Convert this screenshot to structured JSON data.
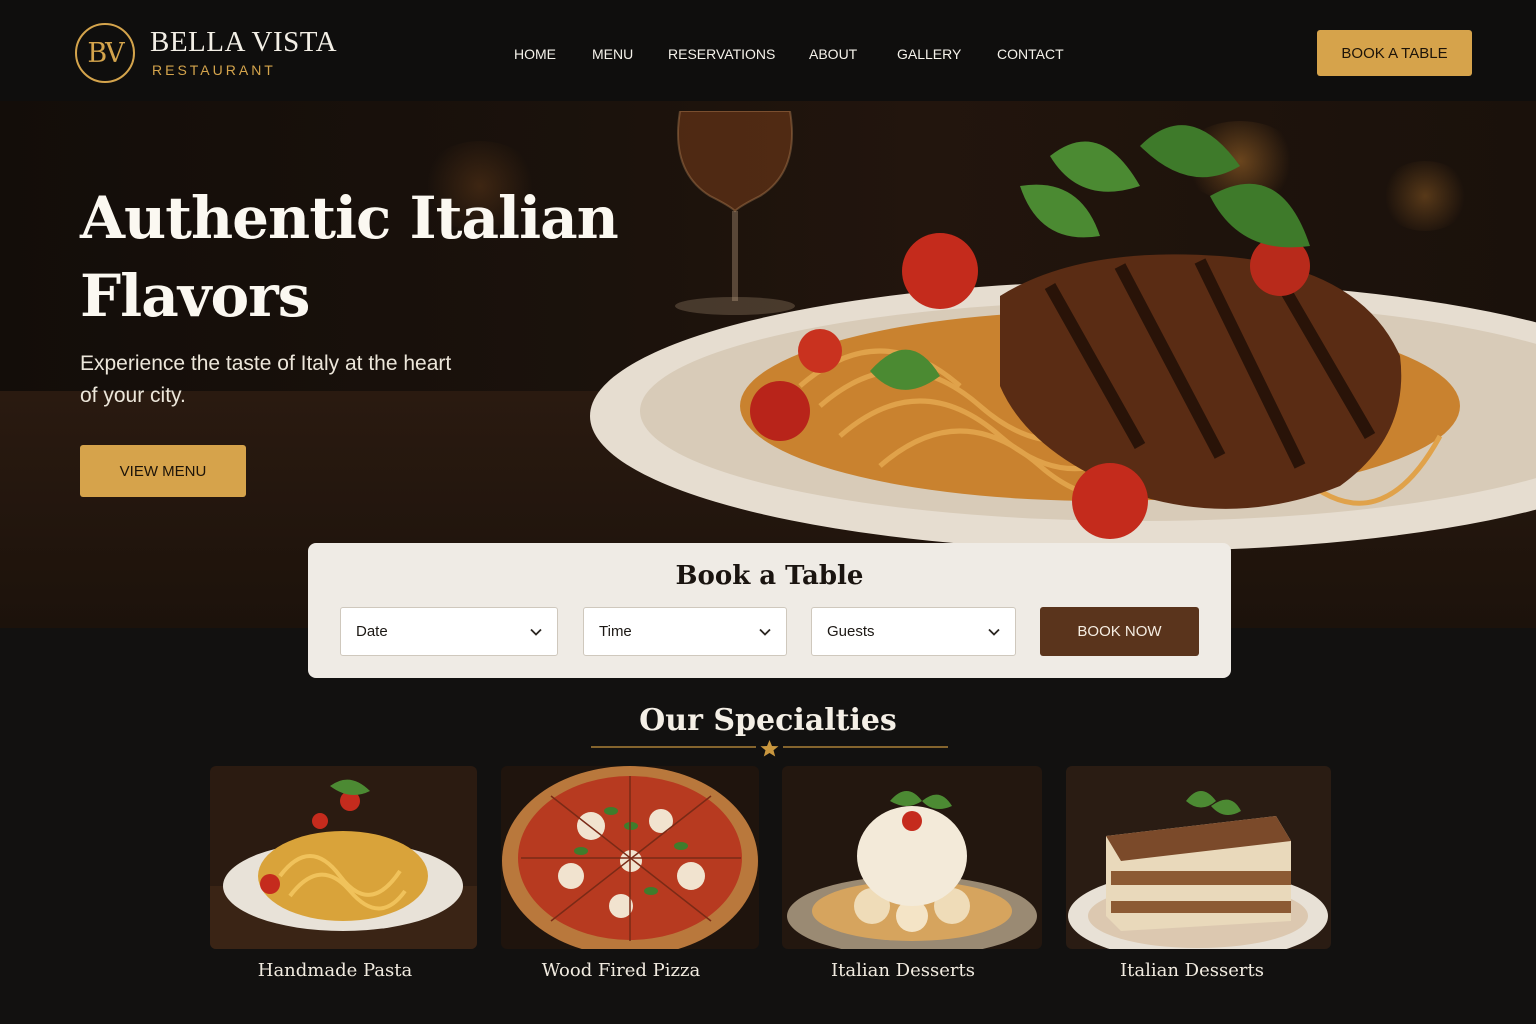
{
  "brand": {
    "monogram": "BV",
    "name": "BELLA VISTA",
    "tagline": "RESTAURANT",
    "accent_color": "#d6a34b"
  },
  "nav": {
    "items": [
      "HOME",
      "MENU",
      "RESERVATIONS",
      "ABOUT",
      "GALLERY",
      "CONTACT"
    ],
    "cta_label": "BOOK A TABLE"
  },
  "hero": {
    "title_line1": "Authentic Italian",
    "title_line2": "Flavors",
    "subtitle": "Experience the taste of Italy at the heart of your city.",
    "cta_label": "VIEW MENU"
  },
  "booking": {
    "title": "Book a Table",
    "fields": [
      {
        "label": "Date",
        "icon": "chevron-down-icon"
      },
      {
        "label": "Time",
        "icon": "chevron-down-icon"
      },
      {
        "label": "Guests",
        "icon": "chevron-down-icon"
      }
    ],
    "submit_label": "BOOK NOW",
    "submit_color": "#5a341c"
  },
  "specialties": {
    "title": "Our Specialties",
    "divider_icon": "star-icon",
    "items": [
      {
        "label": "Handmade Pasta"
      },
      {
        "label": "Wood Fired Pizza"
      },
      {
        "label": "Italian Desserts"
      },
      {
        "label": "Italian Desserts"
      }
    ]
  }
}
